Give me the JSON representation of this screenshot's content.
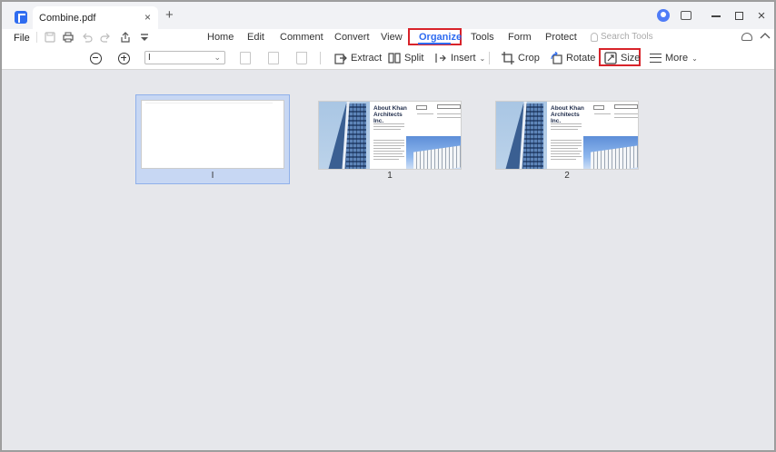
{
  "window": {
    "tab_title": "Combine.pdf",
    "tab_close": "×",
    "new_tab": "+"
  },
  "menubar": {
    "file": "File",
    "nav": [
      "Home",
      "Edit",
      "Comment",
      "Convert",
      "View",
      "Organize",
      "Tools",
      "Form",
      "Protect"
    ],
    "active": "Organize",
    "search_placeholder": "Search Tools"
  },
  "toolbar": {
    "page_input_value": "I",
    "extract": "Extract",
    "split": "Split",
    "insert": "Insert",
    "crop": "Crop",
    "rotate": "Rotate",
    "size": "Size",
    "more": "More"
  },
  "pages": [
    {
      "label": "I",
      "kind": "blank",
      "selected": true
    },
    {
      "label": "1",
      "kind": "brochure",
      "title": "About Khan Architects Inc."
    },
    {
      "label": "2",
      "kind": "brochure",
      "title": "About Khan Architects Inc."
    }
  ],
  "colors": {
    "accent": "#2f6cf0",
    "highlight_box": "#d8232a",
    "selection": "#c7d7f3"
  }
}
